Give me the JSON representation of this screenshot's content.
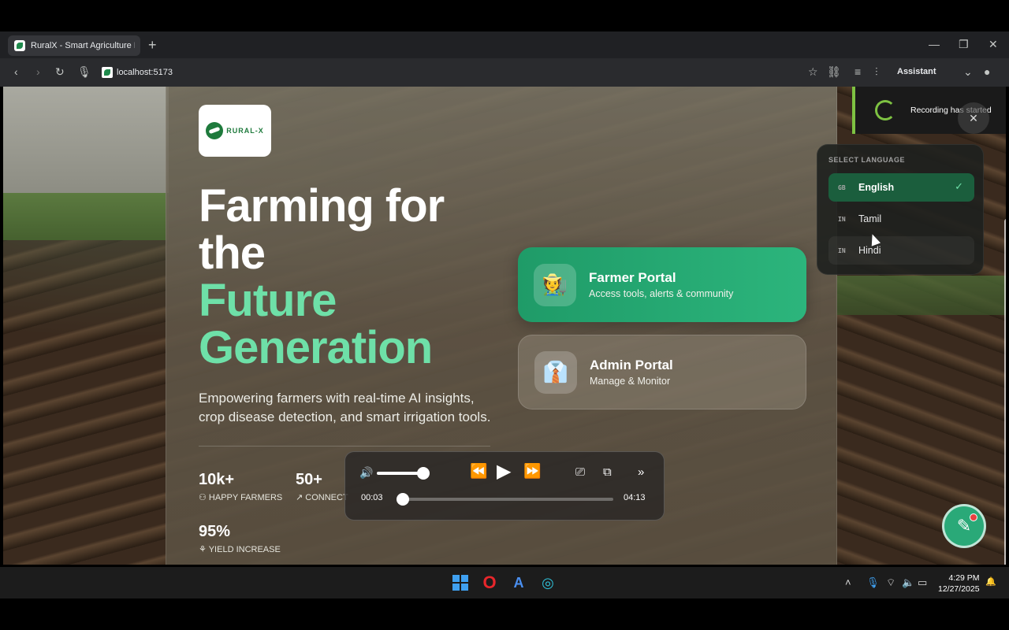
{
  "browser": {
    "tab_title": "RuralX - Smart Agriculture Ec",
    "new_tab": "+",
    "url": "localhost:5173",
    "assistant_label": "Assistant"
  },
  "page": {
    "logo_text": "RURAL-X",
    "hero": {
      "line1": "Farming for",
      "line2": "the",
      "line3": "Future",
      "line4": "Generation"
    },
    "subtitle": "Empowering farmers with real-time AI insights, crop disease detection, and smart irrigation tools.",
    "stats": [
      {
        "value": "10k+",
        "label": "HAPPY FARMERS",
        "icon": "people-icon"
      },
      {
        "value": "50+",
        "label": "CONNECT",
        "icon": "trend-icon"
      },
      {
        "value": "95%",
        "label": "YIELD INCREASE",
        "icon": "sprout-icon"
      }
    ],
    "portals": [
      {
        "title": "Farmer Portal",
        "subtitle": "Access tools, alerts & community",
        "icon": "farmer-icon"
      },
      {
        "title": "Admin Portal",
        "subtitle": "Manage & Monitor",
        "icon": "admin-icon"
      }
    ]
  },
  "player": {
    "current_time": "00:03",
    "duration": "04:13",
    "progress": 0.012,
    "volume": 0.85
  },
  "toast": {
    "text": "Recording has started"
  },
  "language_menu": {
    "heading": "SELECT LANGUAGE",
    "items": [
      {
        "code": "GB",
        "name": "English",
        "selected": true
      },
      {
        "code": "IN",
        "name": "Tamil",
        "selected": false
      },
      {
        "code": "IN",
        "name": "Hindi",
        "selected": false
      }
    ]
  },
  "taskbar": {
    "time": "4:29 PM",
    "date": "12/27/2025"
  },
  "colors": {
    "accent_green": "#6ee0a8",
    "portal_green": "#1f9b68",
    "recording_green": "#7ec242"
  }
}
